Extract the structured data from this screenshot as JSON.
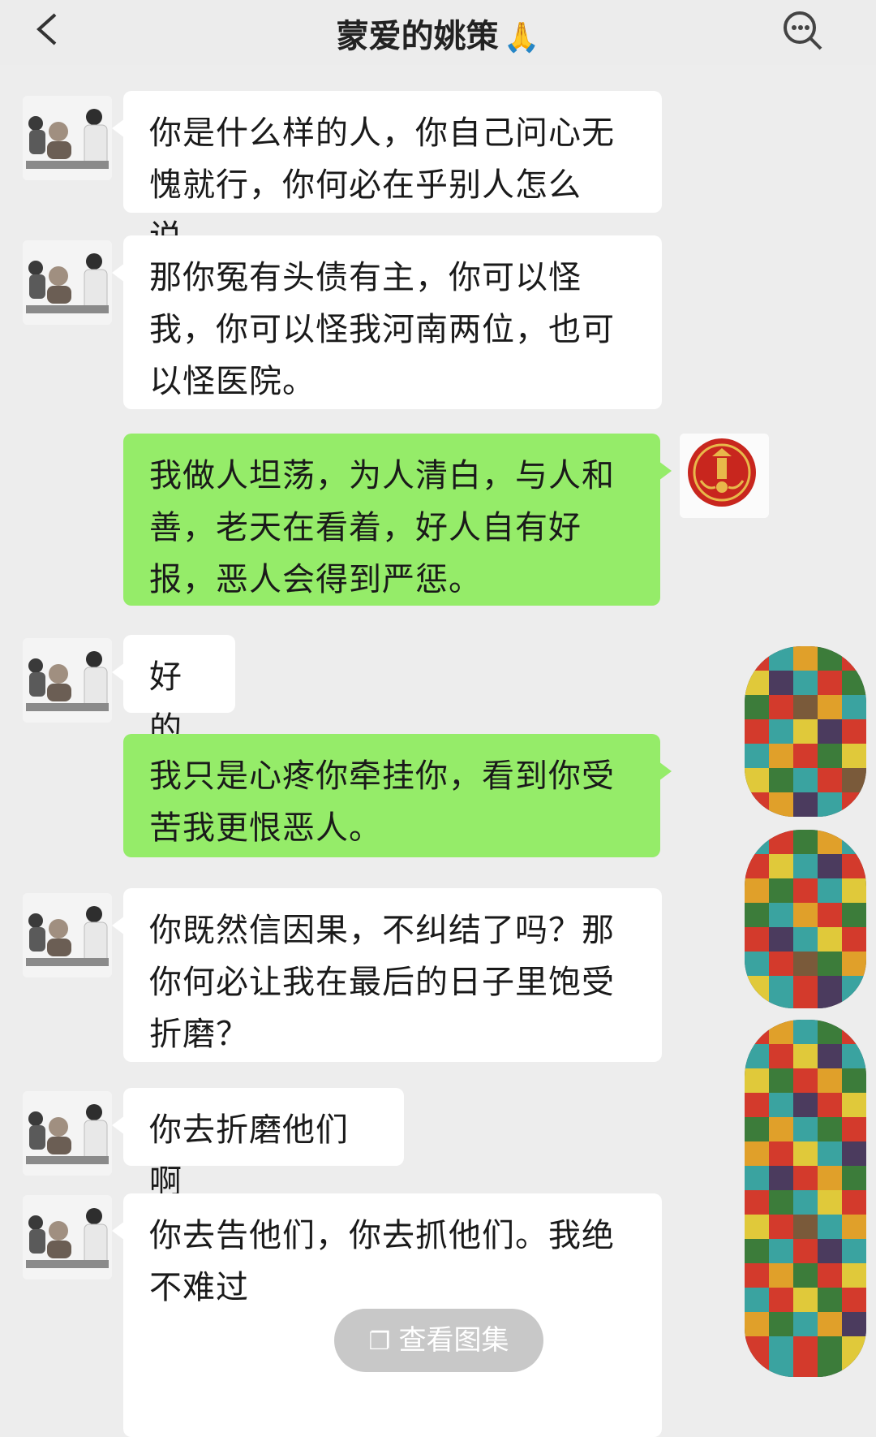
{
  "header": {
    "title": "蒙爱的姚策",
    "title_emoji": "🙏"
  },
  "messages": [
    {
      "side": "in",
      "text": "你是什么样的人，你自己问心无愧就行，你何必在乎别人怎么说。"
    },
    {
      "side": "in",
      "text": "那你冤有头债有主，你可以怪我，你可以怪我河南两位，也可以怪医院。"
    },
    {
      "side": "out",
      "text": "我做人坦荡，为人清白，与人和善，老天在看着，好人自有好报，恶人会得到严惩。"
    },
    {
      "side": "in",
      "text": "好的"
    },
    {
      "side": "out",
      "text": "我只是心疼你牵挂你，看到你受苦我更恨恶人。"
    },
    {
      "side": "in",
      "text": "你既然信因果，不纠结了吗？那你何必让我在最后的日子里饱受折磨？"
    },
    {
      "side": "in",
      "text": "你去折磨他们啊"
    },
    {
      "side": "in",
      "text": "你去告他们，你去抓他们。我绝不难过"
    }
  ],
  "gallery_button": {
    "label": "查看图集",
    "icon": "gallery-icon"
  },
  "colors": {
    "background": "#ededed",
    "incoming_bubble": "#ffffff",
    "outgoing_bubble": "#95ec69"
  }
}
